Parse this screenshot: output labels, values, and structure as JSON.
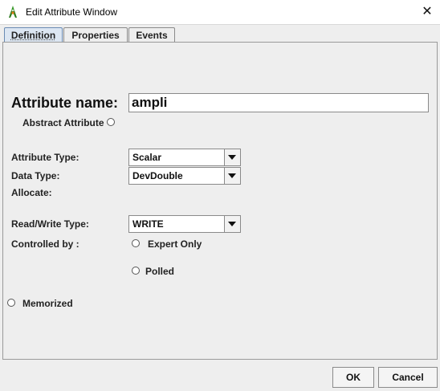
{
  "window": {
    "title": "Edit Attribute Window",
    "close_glyph": "✕"
  },
  "tabs": [
    {
      "label": "Definition",
      "active": true
    },
    {
      "label": "Properties",
      "active": false
    },
    {
      "label": "Events",
      "active": false
    }
  ],
  "form": {
    "attribute_name_label": "Attribute name:",
    "attribute_name_value": "ampli",
    "abstract_attribute_label": "Abstract Attribute",
    "attribute_type_label": "Attribute Type:",
    "attribute_type_value": "Scalar",
    "data_type_label": "Data Type:",
    "data_type_value": "DevDouble",
    "allocate_label": "Allocate:",
    "read_write_type_label": "Read/Write Type:",
    "read_write_type_value": "WRITE",
    "controlled_by_label": "Controlled by :",
    "expert_only_label": "Expert Only",
    "polled_label": "Polled",
    "memorized_label": "Memorized"
  },
  "buttons": {
    "ok": "OK",
    "cancel": "Cancel"
  },
  "icons": {
    "app": "tango-app-icon",
    "close": "close-icon",
    "dropdown": "chevron-down-icon",
    "radio": "radio-icon"
  },
  "colors": {
    "active_tab": "#dce6f2",
    "background": "#eeeeee"
  }
}
